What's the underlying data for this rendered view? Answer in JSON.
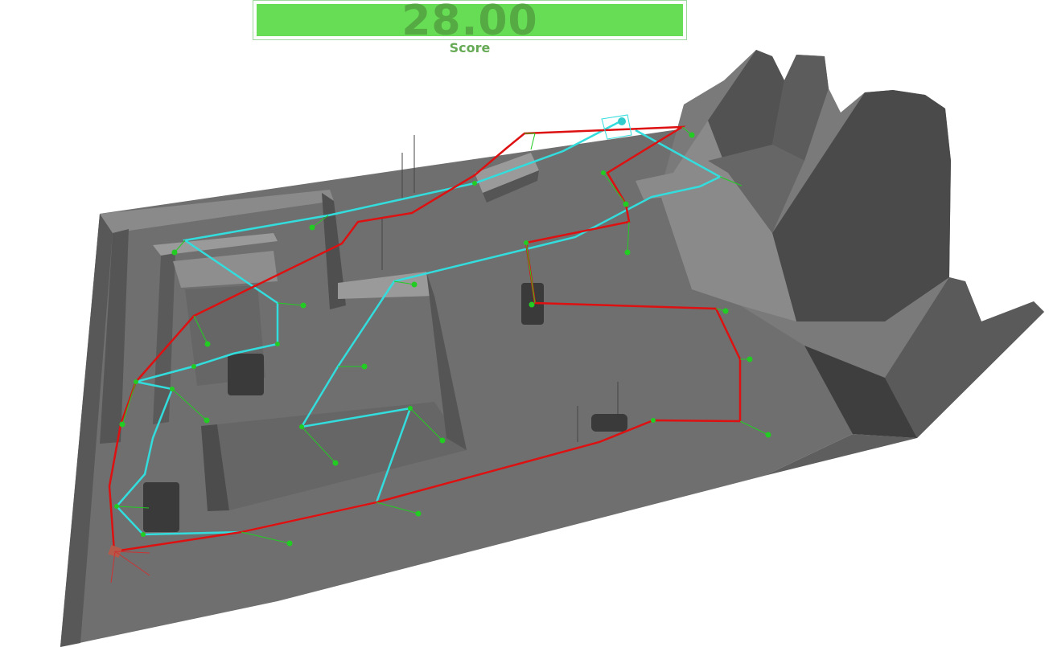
{
  "hud": {
    "score_value": "28.00",
    "score_label": "Score",
    "bar_color": "#66dd55",
    "text_color": "#55aa44"
  },
  "scene": {
    "terrain_color": "#6e6e6e",
    "red_path_color": "#dd1111",
    "cyan_path_color": "#33dddd",
    "waypoint_color": "#22cc22"
  }
}
